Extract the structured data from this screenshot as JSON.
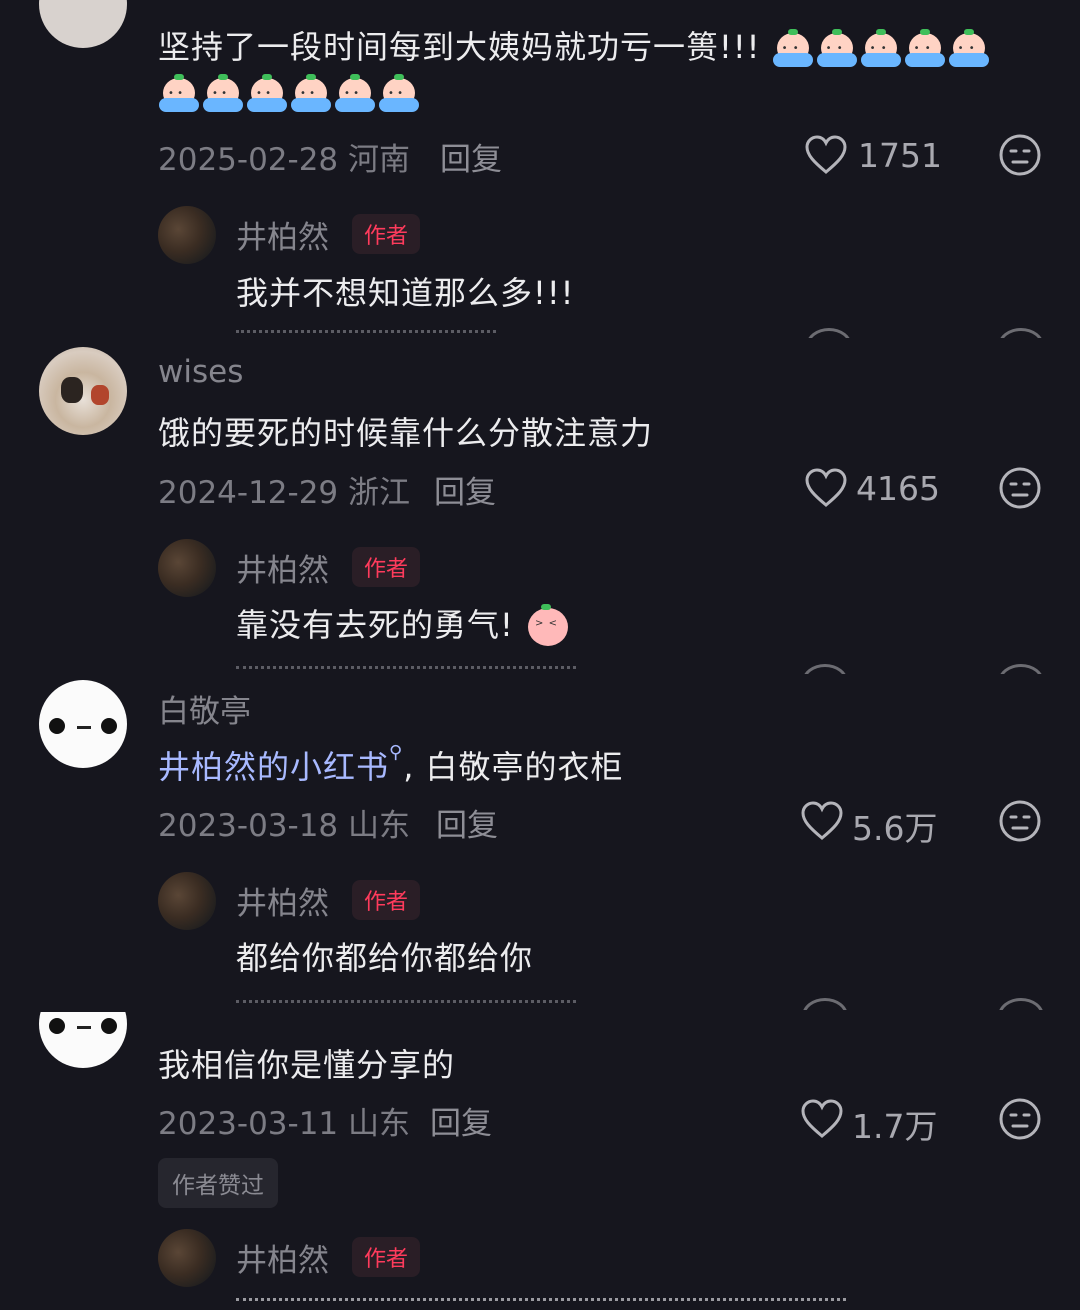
{
  "comments": [
    {
      "comment": "坚持了一段时间每到大姨妈就功亏一篑!!!",
      "date": "2025-02-28",
      "location": "河南",
      "reply_label": "回复",
      "likes": "1751",
      "emoji": "crying-emoji",
      "emoji_count": 11,
      "reply": {
        "username": "井柏然",
        "badge": "作者",
        "comment": "我并不想知道那么多!!!"
      }
    },
    {
      "username": "wises",
      "comment": "饿的要死的时候靠什么分散注意力",
      "date": "2024-12-29",
      "location": "浙江",
      "reply_label": "回复",
      "likes": "4165",
      "reply": {
        "username": "井柏然",
        "badge": "作者",
        "comment": "靠没有去死的勇气!",
        "emoji": "laughing-crying-emoji"
      }
    },
    {
      "username": "白敬亭",
      "comment_link": "井柏然的小红书",
      "comment_rest": ", 白敬亭的衣柜",
      "date": "2023-03-18",
      "location": "山东",
      "reply_label": "回复",
      "likes": "5.6万",
      "reply": {
        "username": "井柏然",
        "badge": "作者",
        "comment": "都给你都给你都给你"
      }
    },
    {
      "comment": "我相信你是懂分享的",
      "date": "2023-03-11",
      "location": "山东",
      "reply_label": "回复",
      "likes": "1.7万",
      "liked_by_author": "作者赞过",
      "reply": {
        "username": "井柏然",
        "badge": "作者"
      }
    }
  ],
  "colors": {
    "background": "#16161e",
    "author_badge": "#ff3b5c",
    "link": "#a8b9ff"
  }
}
